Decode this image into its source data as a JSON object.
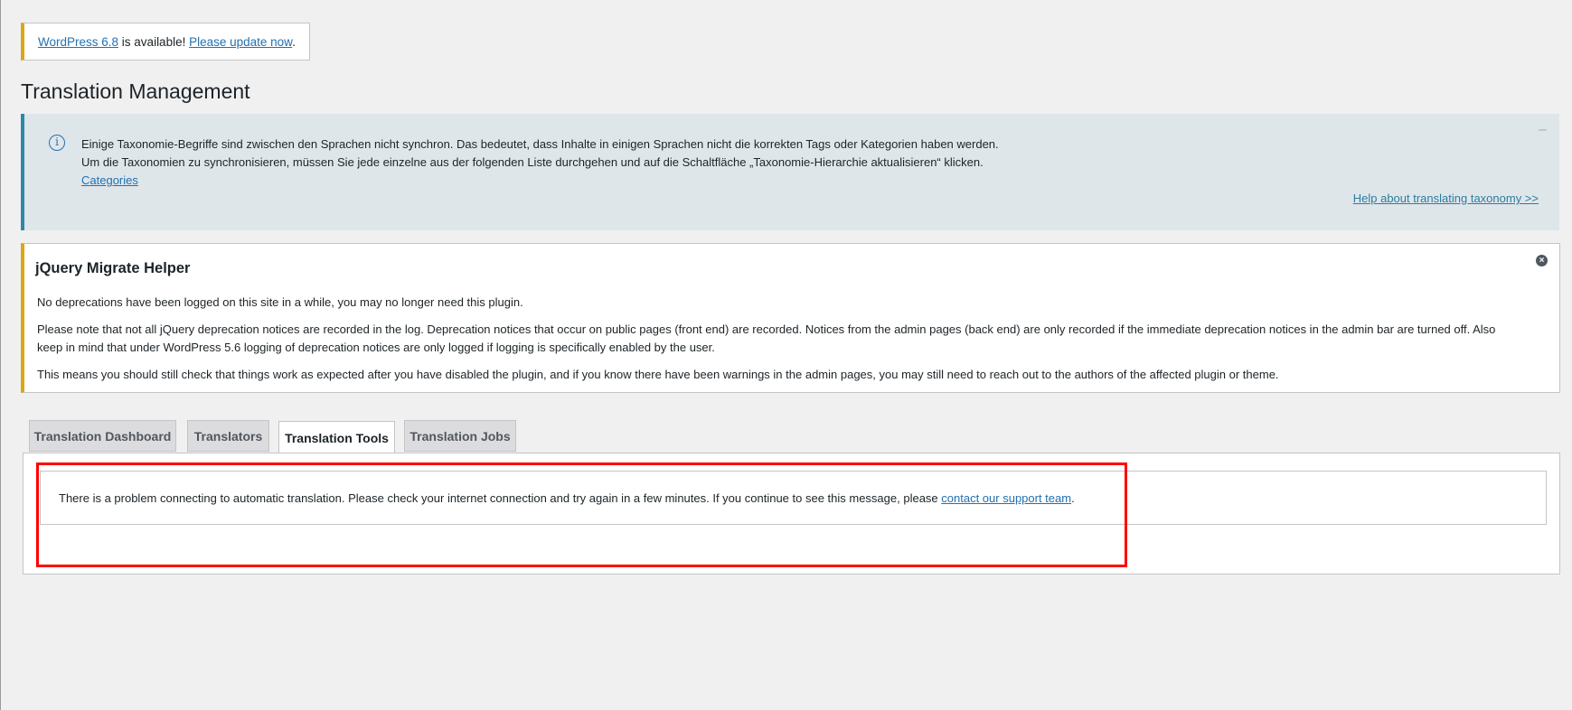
{
  "update_nag": {
    "version_link": "WordPress 6.8",
    "middle_text": " is available! ",
    "update_link": "Please update now",
    "end_text": "."
  },
  "page_title": "Translation Management",
  "info_notice": {
    "line1": "Einige Taxonomie-Begriffe sind zwischen den Sprachen nicht synchron. Das bedeutet, dass Inhalte in einigen Sprachen nicht die korrekten Tags oder Kategorien haben werden.",
    "line2": "Um die Taxonomien zu synchronisieren, müssen Sie jede einzelne aus der folgenden Liste durchgehen und auf die Schaltfläche „Taxonomie-Hierarchie aktualisieren“ klicken.",
    "categories_link": "Categories",
    "help_link": "Help about translating taxonomy >>",
    "icon": "info-icon",
    "dismiss_glyph": "–"
  },
  "jquery_notice": {
    "title": "jQuery Migrate Helper",
    "p1": "No deprecations have been logged on this site in a while, you may no longer need this plugin.",
    "p2": "Please note that not all jQuery deprecation notices are recorded in the log. Deprecation notices that occur on public pages (front end) are recorded. Notices from the admin pages (back end) are only recorded if the immediate deprecation notices in the admin bar are turned off. Also keep in mind that under WordPress 5.6 logging of deprecation notices are only logged if logging is specifically enabled by the user.",
    "p3": "This means you should still check that things work as expected after you have disabled the plugin, and if you know there have been warnings in the admin pages, you may still need to reach out to the authors of the affected plugin or theme.",
    "close_glyph": "×"
  },
  "tabs": [
    {
      "label": "Translation Dashboard",
      "active": false
    },
    {
      "label": "Translators",
      "active": false
    },
    {
      "label": "Translation Tools",
      "active": true
    },
    {
      "label": "Translation Jobs",
      "active": false
    }
  ],
  "error_message": {
    "text": "There is a problem connecting to automatic translation. Please check your internet connection and try again in a few minutes. If you continue to see this message, please ",
    "link": "contact our support team",
    "end": "."
  },
  "colors": {
    "link": "#2271b1",
    "warning_border": "#dba617",
    "info_border": "#2c88a6",
    "highlight": "#ff0000"
  }
}
